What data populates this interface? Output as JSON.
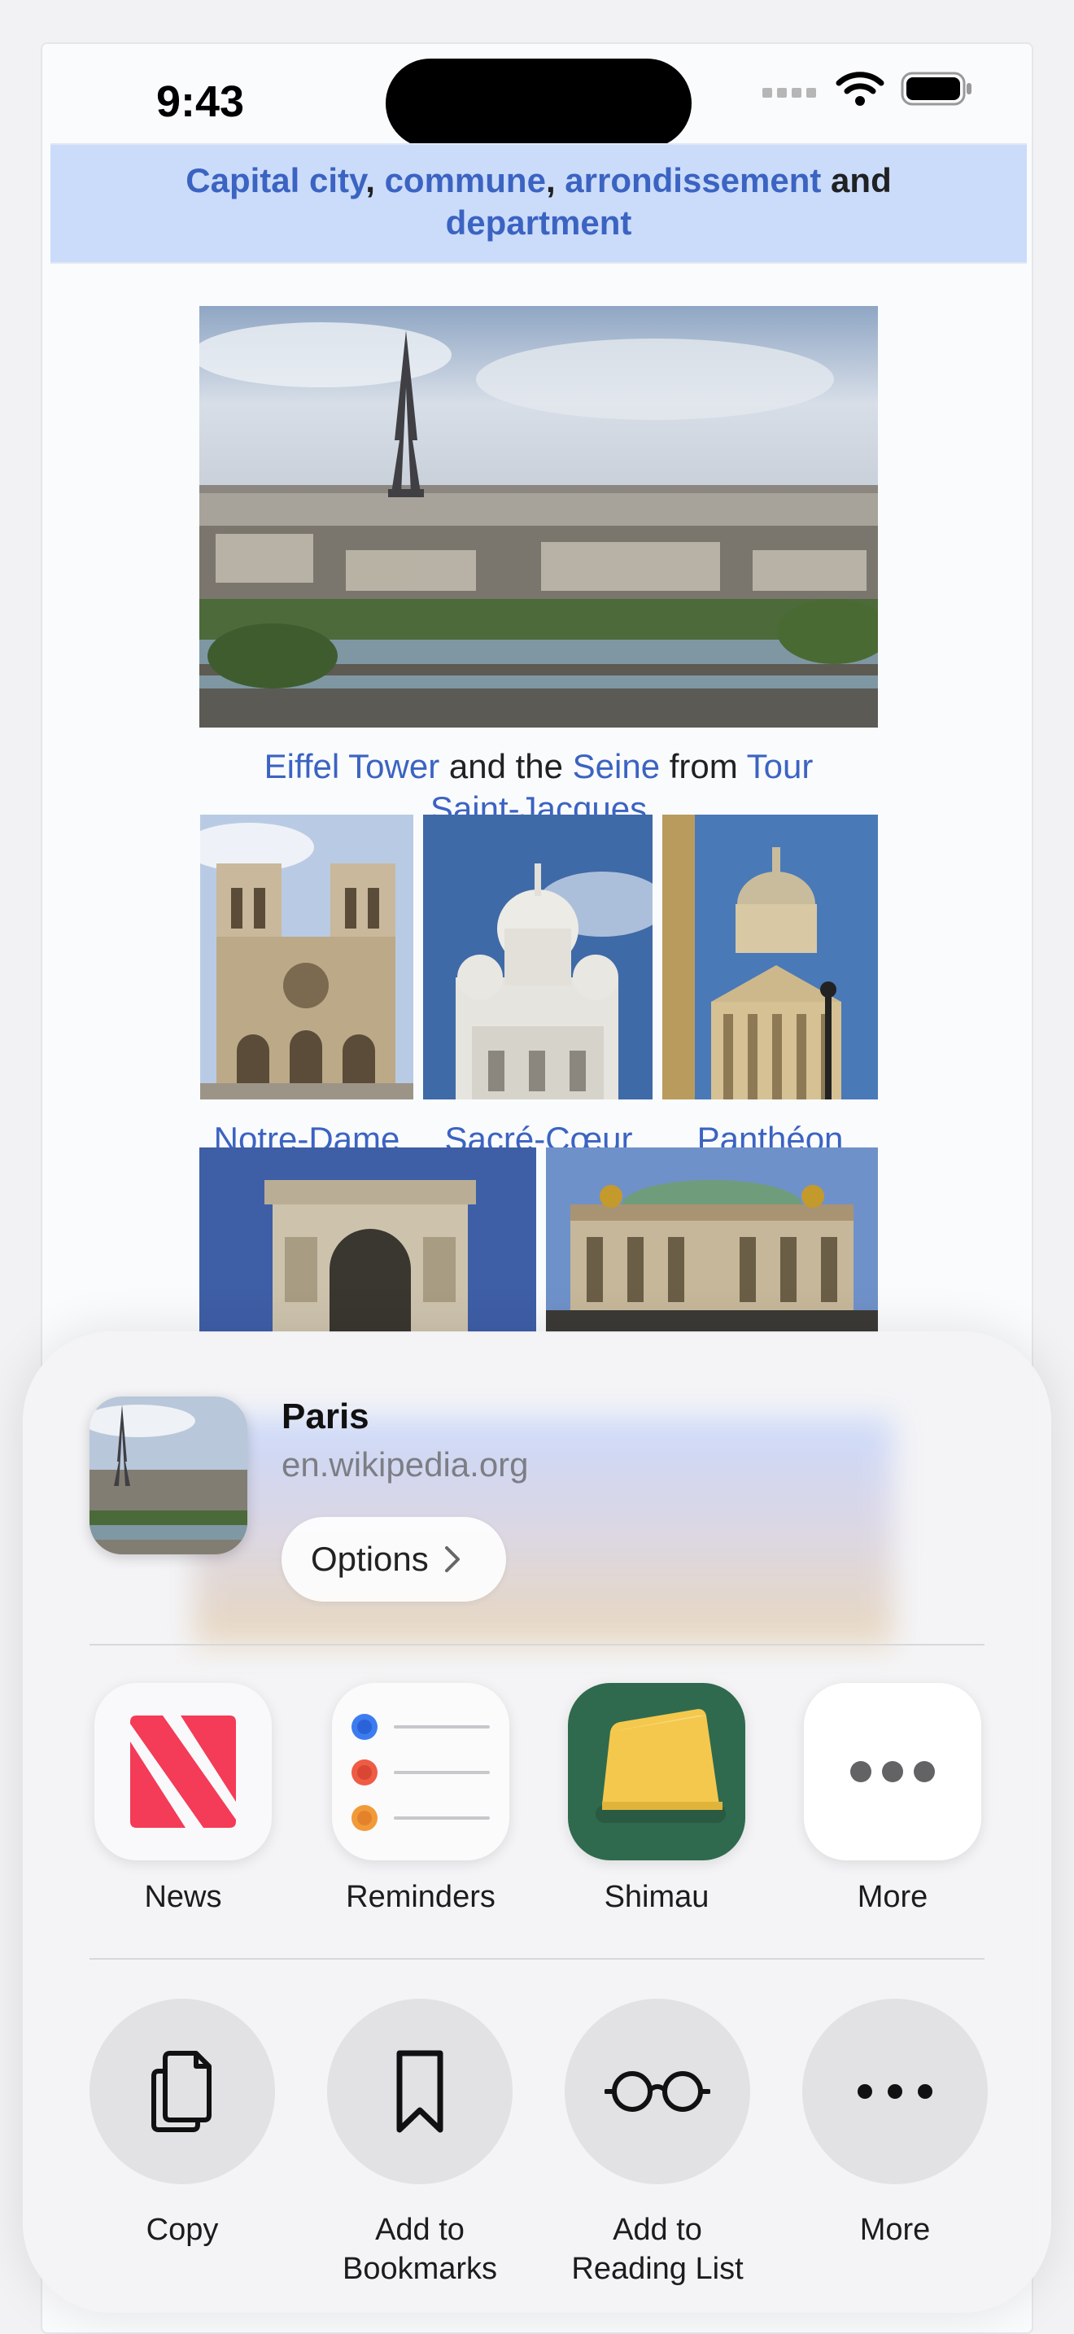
{
  "status_bar": {
    "time": "9:43"
  },
  "infobox": {
    "header_parts": [
      "Capital city",
      ", ",
      "commune",
      ", ",
      "arrondissement",
      " and",
      "department"
    ]
  },
  "captions": {
    "main": {
      "p1": "Eiffel Tower",
      "p2": " and the ",
      "p3": "Seine",
      "p4": " from ",
      "p5": "Tour",
      "p6": "Saint-Jacques"
    },
    "notre_dame": "Notre-Dame",
    "sacre_coeur": "Sacré-Cœur",
    "pantheon": "Panthéon"
  },
  "share_sheet": {
    "title": "Paris",
    "url": "en.wikipedia.org",
    "options_label": "Options",
    "apps": [
      {
        "label": "News",
        "icon": "news-icon"
      },
      {
        "label": "Reminders",
        "icon": "reminders-icon"
      },
      {
        "label": "Shimau",
        "icon": "shimau-icon"
      },
      {
        "label": "More",
        "icon": "more-dots-icon"
      }
    ],
    "actions": [
      {
        "label_line1": "Copy",
        "label_line2": "",
        "icon": "copy-icon"
      },
      {
        "label_line1": "Add to",
        "label_line2": "Bookmarks",
        "icon": "bookmark-icon"
      },
      {
        "label_line1": "Add to",
        "label_line2": "Reading List",
        "icon": "glasses-icon"
      },
      {
        "label_line1": "More",
        "label_line2": "",
        "icon": "more-dots-icon"
      }
    ]
  },
  "colors": {
    "link": "#3b63c2",
    "infobox_header_bg": "#cbdcfa",
    "news_red": "#f43b57",
    "shimau_green": "#2f6a4e",
    "sheet_bg": "#f4f4f6"
  }
}
